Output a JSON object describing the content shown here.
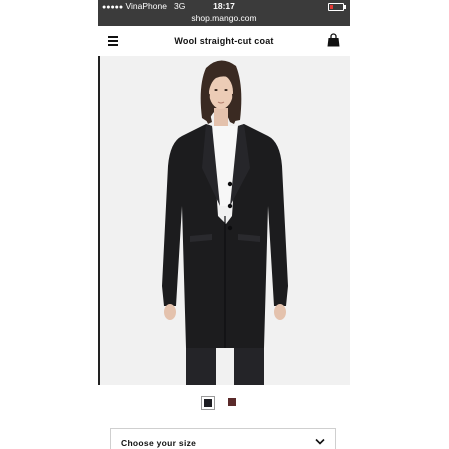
{
  "status_bar": {
    "signal_dots": "●●●●●",
    "carrier": "VinaPhone",
    "network": "3G",
    "time": "18:17",
    "url": "shop.mango.com"
  },
  "header": {
    "title": "Wool straight-cut coat"
  },
  "product": {
    "image_icon": "model-wearing-coat",
    "colors": [
      {
        "name": "black",
        "hex": "#1d1d22",
        "selected": true
      },
      {
        "name": "burgundy",
        "hex": "#5a2a2a",
        "selected": false
      }
    ]
  },
  "size_selector": {
    "label": "Choose your size"
  },
  "colors": {
    "status_bar_bg": "#3b3b3b",
    "coat": "#1c1c1e",
    "background": "#f1f1f1"
  }
}
